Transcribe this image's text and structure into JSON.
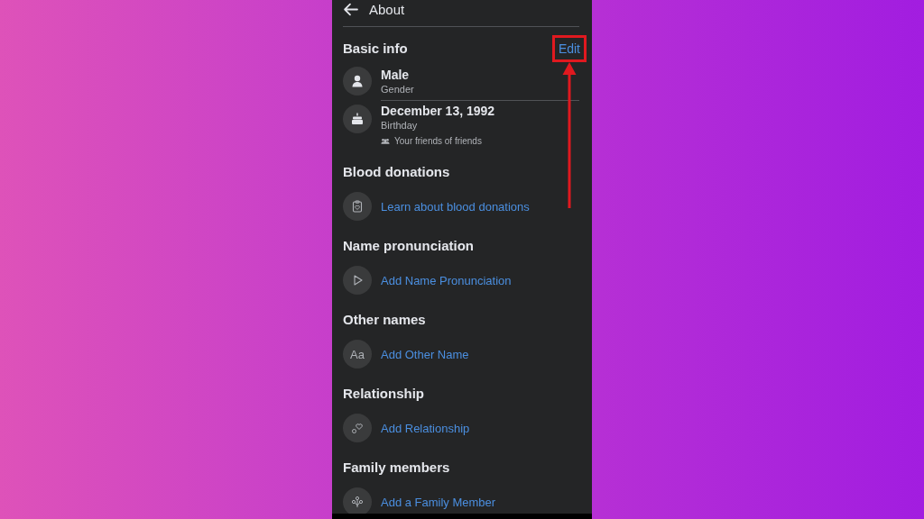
{
  "header": {
    "title": "About"
  },
  "basic_info": {
    "title": "Basic info",
    "edit": "Edit",
    "edit_highlighted": true,
    "entries": [
      {
        "kind": "person",
        "value": "Male",
        "label": "Gender"
      },
      {
        "kind": "cake",
        "value": "December 13, 1992",
        "label": "Birthday",
        "audience": "Your friends of friends"
      }
    ]
  },
  "sections": [
    {
      "title": "Blood donations",
      "action": {
        "kind": "clipboard",
        "text": "Learn about blood donations"
      }
    },
    {
      "title": "Name pronunciation",
      "action": {
        "kind": "play",
        "text": "Add Name Pronunciation"
      }
    },
    {
      "title": "Other names",
      "action": {
        "kind": "text",
        "icon_text": "Aa",
        "text": "Add Other Name"
      }
    },
    {
      "title": "Relationship",
      "action": {
        "kind": "hearts",
        "text": "Add Relationship"
      }
    },
    {
      "title": "Family members",
      "action": {
        "kind": "tree",
        "text": "Add a Family Member"
      }
    }
  ]
}
